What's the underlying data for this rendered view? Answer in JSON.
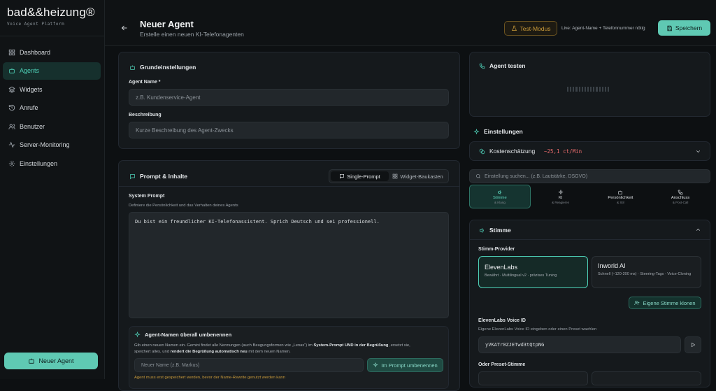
{
  "brand": {
    "logo": "bad&&heizung®",
    "subtitle": "Voice Agent Platform"
  },
  "sidebar": {
    "items": [
      {
        "label": "Dashboard",
        "icon": "grid-icon"
      },
      {
        "label": "Agents",
        "icon": "bot-icon",
        "active": true
      },
      {
        "label": "Widgets",
        "icon": "layers-icon"
      },
      {
        "label": "Anrufe",
        "icon": "history-icon"
      },
      {
        "label": "Benutzer",
        "icon": "users-icon"
      },
      {
        "label": "Server-Monitoring",
        "icon": "activity-icon"
      },
      {
        "label": "Einstellungen",
        "icon": "gear-icon"
      }
    ],
    "new_agent": "Neuer Agent"
  },
  "header": {
    "title": "Neuer Agent",
    "subtitle": "Erstelle einen neuen KI-Telefonagenten",
    "test_mode": "Test-Modus",
    "live_hint": "Live: Agent-Name + Telefonnummer nötig",
    "save": "Speichern"
  },
  "basic": {
    "title": "Grundeinstellungen",
    "name_label": "Agent Name *",
    "name_placeholder": "z.B. Kundenservice-Agent",
    "desc_label": "Beschreibung",
    "desc_placeholder": "Kurze Beschreibung des Agent-Zwecks"
  },
  "prompt": {
    "title": "Prompt & Inhalte",
    "mode_single": "Single-Prompt",
    "mode_widget": "Widget-Baukasten",
    "system_label": "System Prompt",
    "system_hint": "Definiere die Persönlichkeit und das Verhalten deines Agents",
    "system_value": "Du bist ein freundlicher KI-Telefonassistent. Sprich Deutsch und sei professionell.",
    "rename_title": "Agent-Namen überall umbenennen",
    "rename_desc_1": "Gib einen neuen Namen ein. Gemini findet alle Nennungen (auch Beugungsformen wie „Lenas“) im ",
    "rename_desc_bold1": "System-Prompt UND in der Begrüßung",
    "rename_desc_2": ", ersetzt sie,",
    "rename_desc_3": "speichert alles, und ",
    "rename_desc_bold2": "rendert die Begrüßung automatisch neu",
    "rename_desc_4": " mit dem neuen Namen.",
    "rename_placeholder": "Neuer Name (z.B. Markus)",
    "rename_button": "Im Prompt umbenennen",
    "rename_warning": "Agent muss erst gespeichert werden, bevor der Name-Rewrite genutzt werden kann"
  },
  "test": {
    "title": "Agent testen"
  },
  "settings": {
    "title": "Einstellungen",
    "cost_label": "Kostenschätzung",
    "cost_value": "~25,1 ct/Min",
    "search_placeholder": "Einstellung suchen... (z.B. Lautstärke, DSGVO)",
    "tabs": [
      {
        "label": "Stimme",
        "sub": "& Klang",
        "icon": "volume-icon",
        "active": true
      },
      {
        "label": "KI",
        "sub": "& Reagieren",
        "icon": "sparkle-icon"
      },
      {
        "label": "Persönlichkeit",
        "sub": "& Stil",
        "icon": "bot-icon"
      },
      {
        "label": "Anschluss",
        "sub": "& Post-Call",
        "icon": "phone-icon"
      }
    ]
  },
  "voice": {
    "title": "Stimme",
    "provider_label": "Stimm-Provider",
    "providers": [
      {
        "name": "ElevenLabs",
        "desc": "Bewährt · Multilingual v2 · präzises Tuning",
        "selected": true
      },
      {
        "name": "Inworld AI",
        "desc": "Schnell (~120-200 ms) · Steering-Tags · Voice-Cloning"
      }
    ],
    "clone_button": "Eigene Stimme klonen",
    "voice_id_label": "ElevenLabs Voice ID",
    "voice_id_hint": "Eigene ElevenLabs Voice ID eingeben oder einen Preset waehlen",
    "voice_id_value": "yVKATr0ZJETwd3tQtpNG",
    "preset_label": "Oder Preset-Stimme"
  },
  "colors": {
    "accent": "#5fc9b3",
    "warning": "#c99a3a",
    "cost": "#e86b6b"
  }
}
